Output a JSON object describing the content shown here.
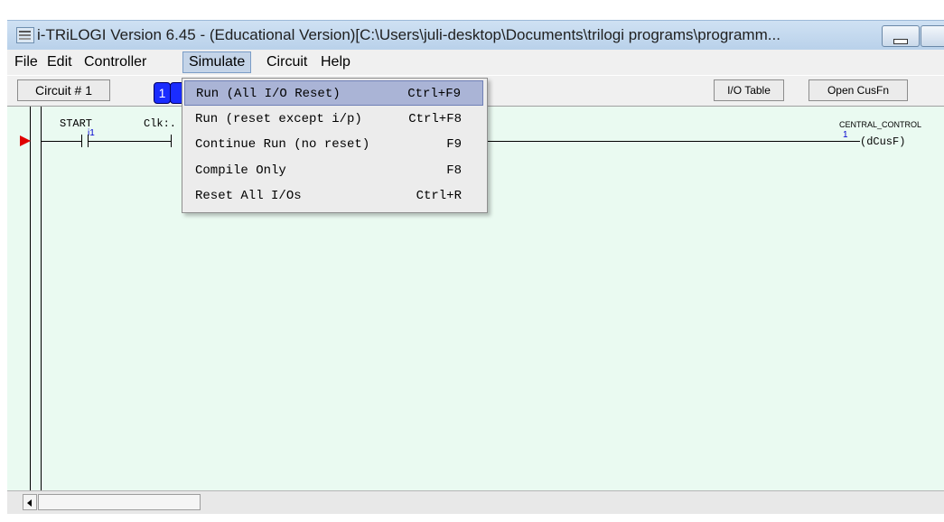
{
  "window": {
    "title": "i-TRiLOGI Version 6.45  - (Educational Version)[C:\\Users\\juli-desktop\\Documents\\trilogi programs\\programm..."
  },
  "menubar": {
    "items": [
      "File",
      "Edit",
      "Controller",
      "Simulate",
      "Circuit",
      "Help"
    ],
    "active": "Simulate"
  },
  "toolbar": {
    "circuit_label": "Circuit # 1",
    "circuit_index": "1",
    "io_table_label": "I/O Table",
    "open_cusfn_label": "Open CusFn"
  },
  "ladder": {
    "contact_label": "START",
    "contact_tag": "i1",
    "clock_label": "Clk:.",
    "coil_label": "CENTRAL_CONTROL",
    "coil_index": "1",
    "coil_function": "(dCusF)"
  },
  "simulate_menu": {
    "items": [
      {
        "label": "Run (All I/O Reset)",
        "accel": "Ctrl+F9",
        "selected": true
      },
      {
        "label": "Run (reset except i/p)",
        "accel": "Ctrl+F8",
        "selected": false
      },
      {
        "label": "Continue Run (no reset)",
        "accel": "F9",
        "selected": false
      },
      {
        "label": "Compile Only",
        "accel": "F8",
        "selected": false
      },
      {
        "label": "Reset All I/Os",
        "accel": "Ctrl+R",
        "selected": false
      }
    ]
  },
  "colors": {
    "canvas_bg": "#eafaf1",
    "menu_highlight": "#aab4d6",
    "active_menu": "#c4d4e8",
    "rung_arrow": "#e00000",
    "index_badge": "#1a2cff"
  }
}
